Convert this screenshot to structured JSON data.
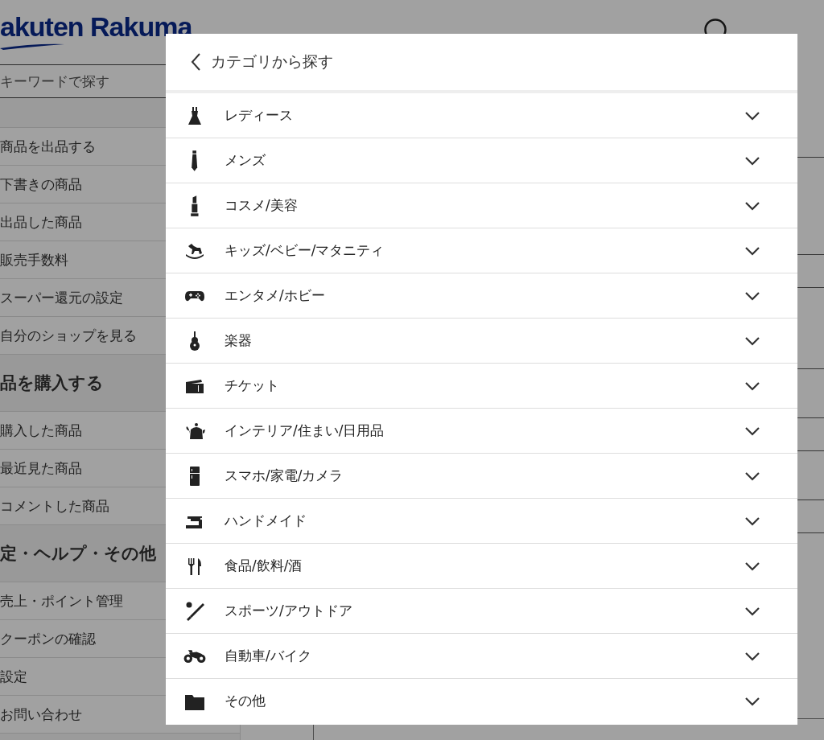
{
  "header": {
    "logo": "akuten Rakuma"
  },
  "sidebar": {
    "search": {
      "placeholder": "キーワードで探す"
    },
    "sections": [
      {
        "items": [
          "商品を出品する",
          "下書きの商品",
          "出品した商品",
          "販売手数料",
          "スーパー還元の設定",
          "自分のショップを見る"
        ]
      },
      {
        "title": "品を購入する",
        "items": [
          "購入した商品",
          "最近見た商品",
          "コメントした商品"
        ]
      },
      {
        "title": "定・ヘルプ・その他",
        "items": [
          "売上・ポイント管理",
          "クーポンの確認",
          "設定",
          "お問い合わせ"
        ]
      }
    ]
  },
  "modal": {
    "title": "カテゴリから探す",
    "categories": [
      {
        "label": "レディース",
        "expanded": false
      },
      {
        "label": "メンズ",
        "expanded": false
      },
      {
        "label": "コスメ/美容",
        "expanded": false
      },
      {
        "label": "キッズ/ベビー/マタニティ",
        "expanded": false
      },
      {
        "label": "エンタメ/ホビー",
        "expanded": false
      },
      {
        "label": "楽器",
        "expanded": false
      },
      {
        "label": "チケット",
        "expanded": false
      },
      {
        "label": "インテリア/住まい/日用品",
        "expanded": false
      },
      {
        "label": "スマホ/家電/カメラ",
        "expanded": false
      },
      {
        "label": "ハンドメイド",
        "expanded": false
      },
      {
        "label": "食品/飲料/酒",
        "expanded": false
      },
      {
        "label": "スポーツ/アウトドア",
        "expanded": false
      },
      {
        "label": "自動車/バイク",
        "expanded": false
      },
      {
        "label": "その他",
        "expanded": false
      }
    ]
  }
}
